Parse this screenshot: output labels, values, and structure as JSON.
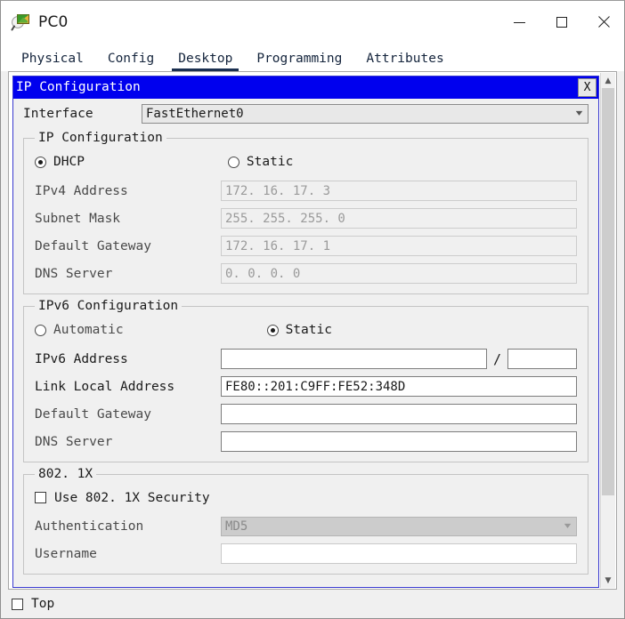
{
  "window": {
    "title": "PC0",
    "icon": "packet-tracer-device-icon",
    "controls": {
      "minimize": "—",
      "maximize": "□",
      "close": "✕"
    }
  },
  "tabs": [
    {
      "label": "Physical",
      "active": false
    },
    {
      "label": "Config",
      "active": false
    },
    {
      "label": "Desktop",
      "active": true
    },
    {
      "label": "Programming",
      "active": false
    },
    {
      "label": "Attributes",
      "active": false
    }
  ],
  "app": {
    "title": "IP Configuration",
    "close_label": "X",
    "titlebar_color": "#0000ee",
    "interface": {
      "label": "Interface",
      "value": "FastEthernet0"
    },
    "ipv4": {
      "legend": "IP Configuration",
      "mode_dhcp": "DHCP",
      "mode_static": "Static",
      "selected_mode": "DHCP",
      "fields": [
        {
          "label": "IPv4 Address",
          "value": "172. 16. 17. 3",
          "disabled": true
        },
        {
          "label": "Subnet Mask",
          "value": "255. 255. 255. 0",
          "disabled": true
        },
        {
          "label": "Default Gateway",
          "value": "172. 16. 17. 1",
          "disabled": true
        },
        {
          "label": "DNS Server",
          "value": "0. 0. 0. 0",
          "disabled": true
        }
      ]
    },
    "ipv6": {
      "legend": "IPv6 Configuration",
      "mode_automatic": "Automatic",
      "mode_static": "Static",
      "selected_mode": "Static",
      "address_label": "IPv6 Address",
      "address_value": "",
      "prefix_separator": "/",
      "prefix_value": "",
      "link_local_label": "Link Local Address",
      "link_local_value": "FE80::201:C9FF:FE52:348D",
      "gateway_label": "Default Gateway",
      "gateway_value": "",
      "dns_label": "DNS Server",
      "dns_value": ""
    },
    "dot1x": {
      "legend": "802. 1X",
      "use_security_label": "Use 802. 1X Security",
      "use_security_checked": false,
      "authentication_label": "Authentication",
      "authentication_value": "MD5",
      "authentication_disabled": true,
      "username_label": "Username",
      "username_value": ""
    }
  },
  "scrollbar": {
    "up_arrow": "▲",
    "down_arrow": "▼"
  },
  "bottom": {
    "top_checkbox_label": "Top",
    "top_checked": false
  }
}
